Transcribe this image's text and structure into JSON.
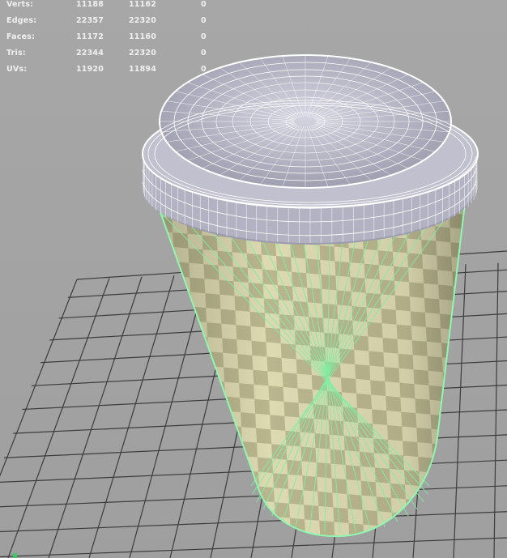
{
  "app": {
    "view": "3D viewport"
  },
  "hud": {
    "rows": [
      {
        "label": "Verts:",
        "values": [
          "11188",
          "11162",
          "0"
        ]
      },
      {
        "label": "Edges:",
        "values": [
          "22357",
          "22320",
          "0"
        ]
      },
      {
        "label": "Faces:",
        "values": [
          "11172",
          "11160",
          "0"
        ]
      },
      {
        "label": "Tris:",
        "values": [
          "22344",
          "22320",
          "0"
        ]
      },
      {
        "label": "UVs:",
        "values": [
          "11920",
          "11894",
          "0"
        ]
      }
    ]
  },
  "colors": {
    "viewport_bg": "#a3a3a3",
    "grid_line": "#3c3c3c",
    "checker_light": "#ddd9b1",
    "checker_dark": "#b9b68e",
    "selection_wire": "#7df0a0",
    "lid_fill": "#b8b8c8",
    "lid_wire": "#ffffff",
    "hud_text": "#f0f0f0"
  }
}
